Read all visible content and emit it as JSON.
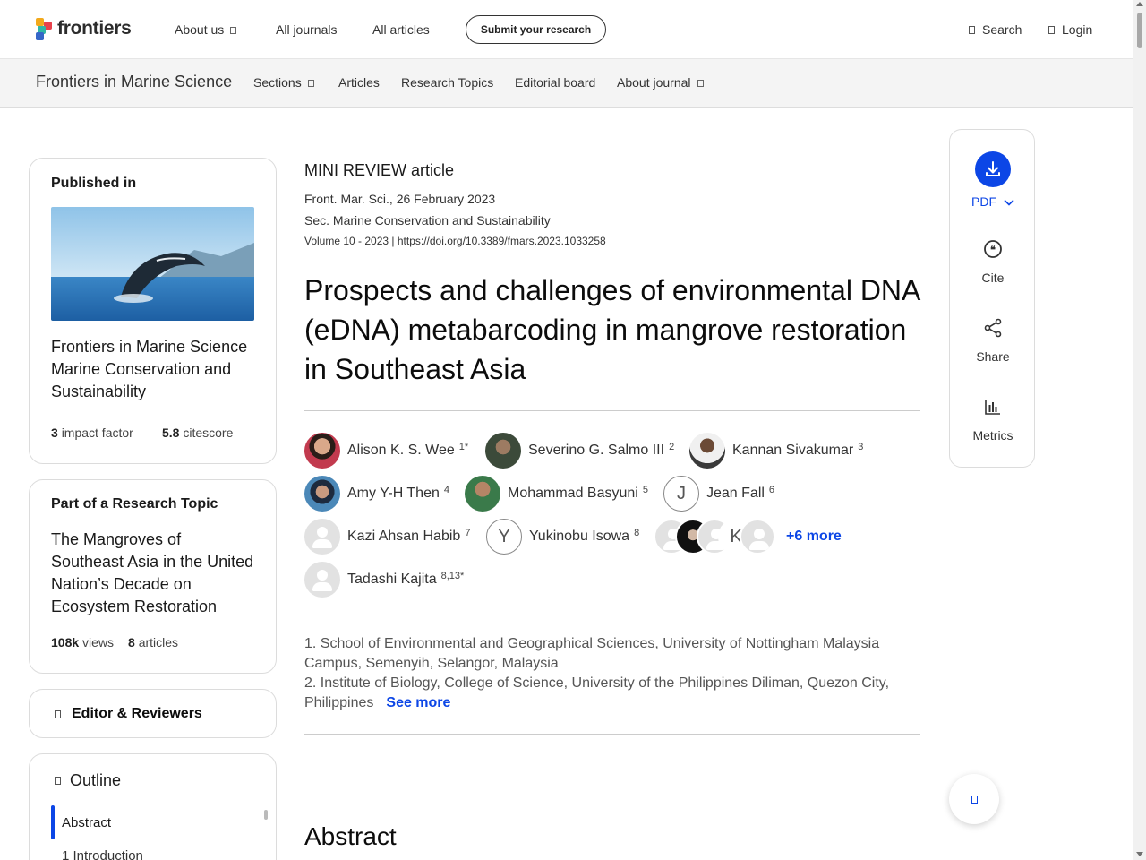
{
  "topnav": {
    "logo_text": "frontiers",
    "about_us": "About us",
    "all_journals": "All journals",
    "all_articles": "All articles",
    "submit": "Submit your research",
    "search": "Search",
    "login": "Login"
  },
  "journalnav": {
    "title": "Frontiers in Marine Science",
    "sections": "Sections",
    "articles": "Articles",
    "research_topics": "Research Topics",
    "editorial_board": "Editorial board",
    "about_journal": "About journal"
  },
  "published_in": {
    "heading": "Published in",
    "journal_lines": [
      "Frontiers in Marine Science",
      "Marine Conservation and",
      "Sustainability"
    ],
    "impact_factor_value": "3",
    "impact_factor_label": "impact factor",
    "citescore_value": "5.8",
    "citescore_label": "citescore"
  },
  "research_topic": {
    "heading": "Part of a Research Topic",
    "title_lines": [
      "The Mangroves of",
      "Southeast Asia in the United",
      "Nation’s Decade on",
      "Ecosystem Restoration"
    ],
    "views_value": "108k",
    "views_label": "views",
    "articles_value": "8",
    "articles_label": "articles"
  },
  "editors": {
    "label": "Editor & Reviewers"
  },
  "outline": {
    "heading": "Outline",
    "items": [
      "Abstract",
      "1 Introduction"
    ]
  },
  "article": {
    "type": "MINI REVIEW article",
    "journal_date": "Front. Mar. Sci., 26 February 2023",
    "section": "Sec. Marine Conservation and Sustainability",
    "volume": "Volume 10 - 2023 | ",
    "doi": "https://doi.org/10.3389/fmars.2023.1033258",
    "title_lines": [
      "Prospects and challenges of environmental DNA",
      "(eDNA) metabarcoding in mangrove restoration",
      "in Southeast Asia"
    ]
  },
  "authors": [
    {
      "name": "Alison K. S. Wee",
      "sup": "1*",
      "avatar": "photo"
    },
    {
      "name": "Severino G. Salmo III",
      "sup": "2",
      "avatar": "photo"
    },
    {
      "name": "Kannan Sivakumar",
      "sup": "3",
      "avatar": "photo"
    },
    {
      "name": "Amy Y-H Then",
      "sup": "4",
      "avatar": "photo"
    },
    {
      "name": "Mohammad Basyuni",
      "sup": "5",
      "avatar": "photo"
    },
    {
      "name": "Jean Fall",
      "sup": "6",
      "avatar": "J"
    },
    {
      "name": "Kazi Ahsan Habib",
      "sup": "7",
      "avatar": "blank"
    },
    {
      "name": "Yukinobu Isowa",
      "sup": "8",
      "avatar": "Y"
    },
    {
      "name": "Tadashi Kajita",
      "sup": "8,13*",
      "avatar": "blank"
    }
  ],
  "more_authors": {
    "label": "+6 more",
    "stack_letter": "K"
  },
  "affiliations": {
    "line1": "1. School of Environmental and Geographical Sciences, University of Nottingham Malaysia Campus, Semenyih, Selangor, Malaysia",
    "line2": "2. Institute of Biology, College of Science, University of the Philippines Diliman, Quezon City, Philippines",
    "see_more": "See more"
  },
  "abstract_heading": "Abstract",
  "actions": {
    "pdf": "PDF",
    "cite": "Cite",
    "share": "Share",
    "metrics": "Metrics"
  },
  "colors": {
    "brand_blue": "#0c46e6"
  }
}
